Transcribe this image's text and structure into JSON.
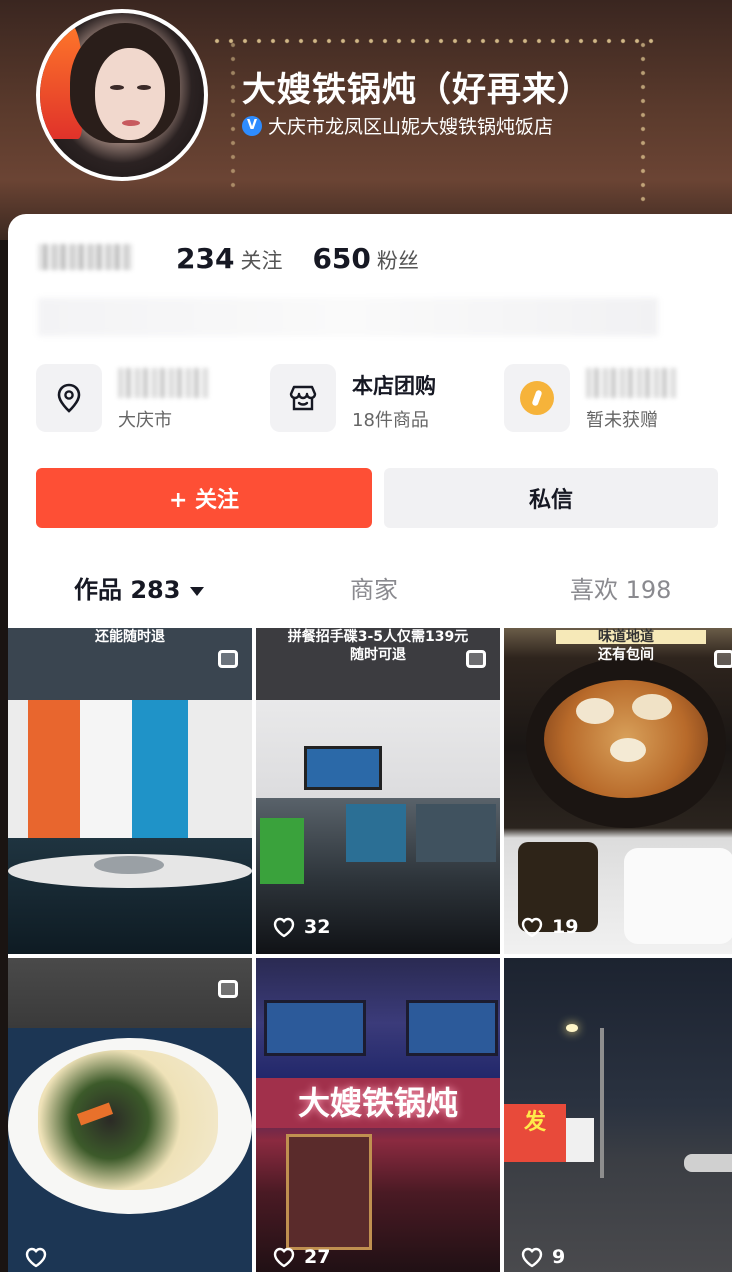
{
  "header": {
    "title": "大嫂铁锅炖（好再来）",
    "verified_badge": "V",
    "verified_text": "大庆市龙凤区山妮大嫂铁锅炖饭店"
  },
  "stats": {
    "following_count": "234",
    "following_label": "关注",
    "followers_count": "650",
    "followers_label": "粉丝"
  },
  "info": {
    "location_sub": "大庆市",
    "shop_title": "本店团购",
    "shop_sub": "18件商品",
    "gift_sub": "暂未获赠"
  },
  "actions": {
    "follow_label": "+ 关注",
    "message_label": "私信"
  },
  "tabs": {
    "works_label": "作品 283",
    "merchant_label": "商家",
    "likes_label": "喜欢 198"
  },
  "grid": {
    "tiles": [
      {
        "caption": "还能随时退",
        "likes": ""
      },
      {
        "caption": "拼餐招手碟3-5人仅需139元",
        "caption2": "随时可退",
        "likes": "32"
      },
      {
        "caption": "味道地道",
        "caption2": "还有包间",
        "likes": "19"
      },
      {
        "caption": "",
        "likes": ""
      },
      {
        "caption": "大嫂铁锅炖",
        "likes": "27"
      },
      {
        "caption": "发",
        "likes": "9"
      }
    ]
  },
  "colors": {
    "follow_button": "#fe4f35",
    "message_button": "#f1f1f3",
    "verified_icon": "#2e8cff",
    "coin": "#f6b33a"
  },
  "icons": [
    "location-pin-icon",
    "shop-bag-icon",
    "coin-icon",
    "multi-image-icon",
    "heart-icon",
    "caret-down-icon",
    "verified-icon"
  ]
}
